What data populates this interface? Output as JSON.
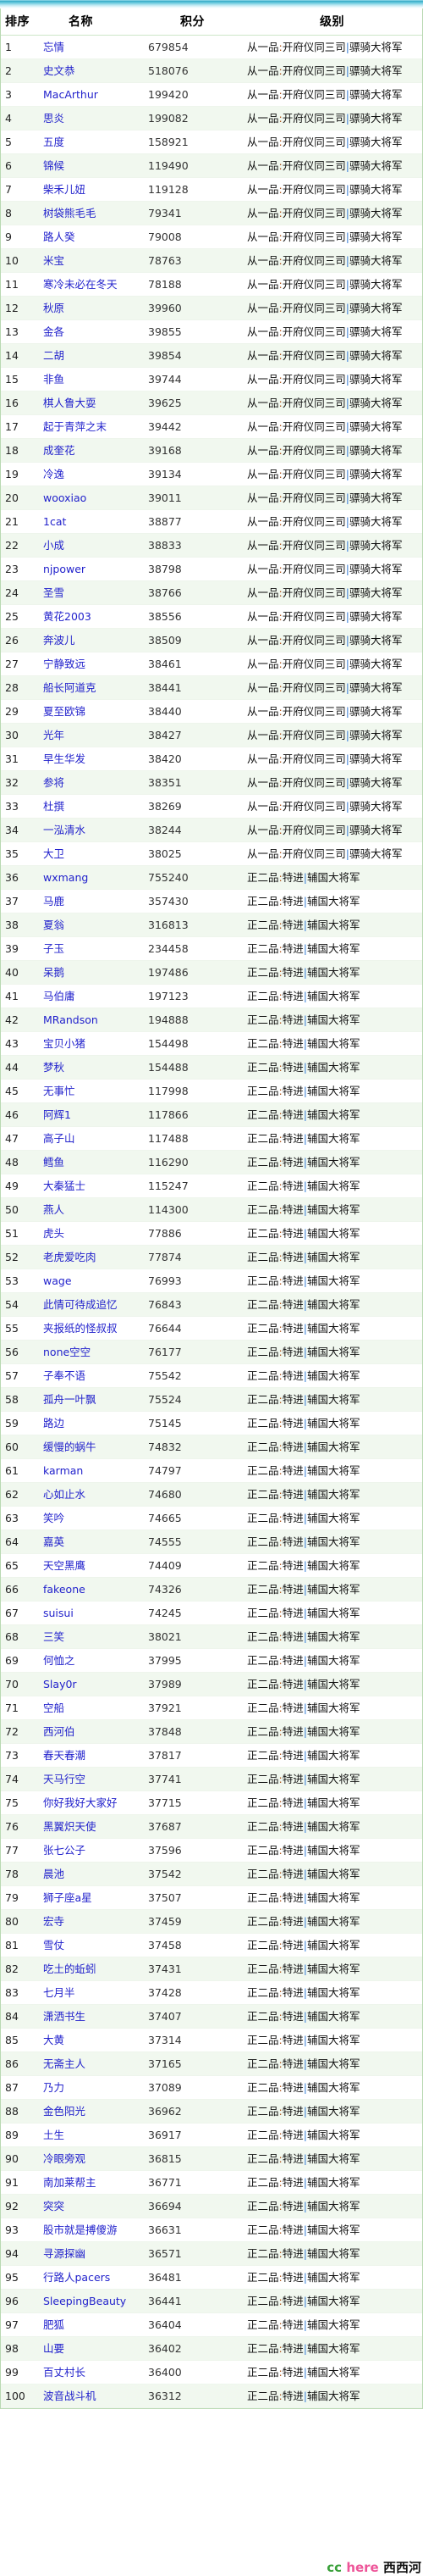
{
  "table": {
    "columns": [
      "排序",
      "名称",
      "积分",
      "级别"
    ],
    "levels": {
      "rank1": "从一品:开府仪同三司|骠骑大将军",
      "rank2": "正二品:特进|辅国大将军"
    },
    "rows": [
      {
        "rank": "1",
        "name": "忘情",
        "score": "679854",
        "grade": "从一品",
        "title": "开府仪同三司",
        "mil": "骠骑大将军"
      },
      {
        "rank": "2",
        "name": "史文恭",
        "score": "518076",
        "grade": "从一品",
        "title": "开府仪同三司",
        "mil": "骠骑大将军"
      },
      {
        "rank": "3",
        "name": "MacArthur",
        "score": "199420",
        "grade": "从一品",
        "title": "开府仪同三司",
        "mil": "骠骑大将军"
      },
      {
        "rank": "4",
        "name": "思炎",
        "score": "199082",
        "grade": "从一品",
        "title": "开府仪同三司",
        "mil": "骠骑大将军"
      },
      {
        "rank": "5",
        "name": "五度",
        "score": "158921",
        "grade": "从一品",
        "title": "开府仪同三司",
        "mil": "骠骑大将军"
      },
      {
        "rank": "6",
        "name": "锦候",
        "score": "119490",
        "grade": "从一品",
        "title": "开府仪同三司",
        "mil": "骠骑大将军"
      },
      {
        "rank": "7",
        "name": "柴禾儿妞",
        "score": "119128",
        "grade": "从一品",
        "title": "开府仪同三司",
        "mil": "骠骑大将军"
      },
      {
        "rank": "8",
        "name": "树袋熊毛毛",
        "score": "79341",
        "grade": "从一品",
        "title": "开府仪同三司",
        "mil": "骠骑大将军"
      },
      {
        "rank": "9",
        "name": "路人癸",
        "score": "79008",
        "grade": "从一品",
        "title": "开府仪同三司",
        "mil": "骠骑大将军"
      },
      {
        "rank": "10",
        "name": "米宝",
        "score": "78763",
        "grade": "从一品",
        "title": "开府仪同三司",
        "mil": "骠骑大将军"
      },
      {
        "rank": "11",
        "name": "寒冷未必在冬天",
        "score": "78188",
        "grade": "从一品",
        "title": "开府仪同三司",
        "mil": "骠骑大将军"
      },
      {
        "rank": "12",
        "name": "秋原",
        "score": "39960",
        "grade": "从一品",
        "title": "开府仪同三司",
        "mil": "骠骑大将军"
      },
      {
        "rank": "13",
        "name": "金各",
        "score": "39855",
        "grade": "从一品",
        "title": "开府仪同三司",
        "mil": "骠骑大将军"
      },
      {
        "rank": "14",
        "name": "二胡",
        "score": "39854",
        "grade": "从一品",
        "title": "开府仪同三司",
        "mil": "骠骑大将军"
      },
      {
        "rank": "15",
        "name": "非鱼",
        "score": "39744",
        "grade": "从一品",
        "title": "开府仪同三司",
        "mil": "骠骑大将军"
      },
      {
        "rank": "16",
        "name": "棋人鲁大耍",
        "score": "39625",
        "grade": "从一品",
        "title": "开府仪同三司",
        "mil": "骠骑大将军"
      },
      {
        "rank": "17",
        "name": "起于青萍之末",
        "score": "39442",
        "grade": "从一品",
        "title": "开府仪同三司",
        "mil": "骠骑大将军"
      },
      {
        "rank": "18",
        "name": "成奎花",
        "score": "39168",
        "grade": "从一品",
        "title": "开府仪同三司",
        "mil": "骠骑大将军"
      },
      {
        "rank": "19",
        "name": "冷逸",
        "score": "39134",
        "grade": "从一品",
        "title": "开府仪同三司",
        "mil": "骠骑大将军"
      },
      {
        "rank": "20",
        "name": "wooxiao",
        "score": "39011",
        "grade": "从一品",
        "title": "开府仪同三司",
        "mil": "骠骑大将军"
      },
      {
        "rank": "21",
        "name": "1cat",
        "score": "38877",
        "grade": "从一品",
        "title": "开府仪同三司",
        "mil": "骠骑大将军"
      },
      {
        "rank": "22",
        "name": "小成",
        "score": "38833",
        "grade": "从一品",
        "title": "开府仪同三司",
        "mil": "骠骑大将军"
      },
      {
        "rank": "23",
        "name": "njpower",
        "score": "38798",
        "grade": "从一品",
        "title": "开府仪同三司",
        "mil": "骠骑大将军"
      },
      {
        "rank": "24",
        "name": "圣雪",
        "score": "38766",
        "grade": "从一品",
        "title": "开府仪同三司",
        "mil": "骠骑大将军"
      },
      {
        "rank": "25",
        "name": "黄花2003",
        "score": "38556",
        "grade": "从一品",
        "title": "开府仪同三司",
        "mil": "骠骑大将军"
      },
      {
        "rank": "26",
        "name": "奔波儿",
        "score": "38509",
        "grade": "从一品",
        "title": "开府仪同三司",
        "mil": "骠骑大将军"
      },
      {
        "rank": "27",
        "name": "宁静致远",
        "score": "38461",
        "grade": "从一品",
        "title": "开府仪同三司",
        "mil": "骠骑大将军"
      },
      {
        "rank": "28",
        "name": "船长阿道克",
        "score": "38441",
        "grade": "从一品",
        "title": "开府仪同三司",
        "mil": "骠骑大将军"
      },
      {
        "rank": "29",
        "name": "夏至欧锦",
        "score": "38440",
        "grade": "从一品",
        "title": "开府仪同三司",
        "mil": "骠骑大将军"
      },
      {
        "rank": "30",
        "name": "光年",
        "score": "38427",
        "grade": "从一品",
        "title": "开府仪同三司",
        "mil": "骠骑大将军"
      },
      {
        "rank": "31",
        "name": "早生华发",
        "score": "38420",
        "grade": "从一品",
        "title": "开府仪同三司",
        "mil": "骠骑大将军"
      },
      {
        "rank": "32",
        "name": "参将",
        "score": "38351",
        "grade": "从一品",
        "title": "开府仪同三司",
        "mil": "骠骑大将军"
      },
      {
        "rank": "33",
        "name": "杜撰",
        "score": "38269",
        "grade": "从一品",
        "title": "开府仪同三司",
        "mil": "骠骑大将军"
      },
      {
        "rank": "34",
        "name": "一泓清水",
        "score": "38244",
        "grade": "从一品",
        "title": "开府仪同三司",
        "mil": "骠骑大将军"
      },
      {
        "rank": "35",
        "name": "大卫",
        "score": "38025",
        "grade": "从一品",
        "title": "开府仪同三司",
        "mil": "骠骑大将军"
      },
      {
        "rank": "36",
        "name": "wxmang",
        "score": "755240",
        "grade": "正二品",
        "title": "特进",
        "mil": "辅国大将军"
      },
      {
        "rank": "37",
        "name": "马鹿",
        "score": "357430",
        "grade": "正二品",
        "title": "特进",
        "mil": "辅国大将军"
      },
      {
        "rank": "38",
        "name": "夏翁",
        "score": "316813",
        "grade": "正二品",
        "title": "特进",
        "mil": "辅国大将军"
      },
      {
        "rank": "39",
        "name": "子玉",
        "score": "234458",
        "grade": "正二品",
        "title": "特进",
        "mil": "辅国大将军"
      },
      {
        "rank": "40",
        "name": "呆鹅",
        "score": "197486",
        "grade": "正二品",
        "title": "特进",
        "mil": "辅国大将军"
      },
      {
        "rank": "41",
        "name": "马伯庸",
        "score": "197123",
        "grade": "正二品",
        "title": "特进",
        "mil": "辅国大将军"
      },
      {
        "rank": "42",
        "name": "MRandson",
        "score": "194888",
        "grade": "正二品",
        "title": "特进",
        "mil": "辅国大将军"
      },
      {
        "rank": "43",
        "name": "宝贝小猪",
        "score": "154498",
        "grade": "正二品",
        "title": "特进",
        "mil": "辅国大将军"
      },
      {
        "rank": "44",
        "name": "梦秋",
        "score": "154488",
        "grade": "正二品",
        "title": "特进",
        "mil": "辅国大将军"
      },
      {
        "rank": "45",
        "name": "无事忙",
        "score": "117998",
        "grade": "正二品",
        "title": "特进",
        "mil": "辅国大将军"
      },
      {
        "rank": "46",
        "name": "阿辉1",
        "score": "117866",
        "grade": "正二品",
        "title": "特进",
        "mil": "辅国大将军"
      },
      {
        "rank": "47",
        "name": "高子山",
        "score": "117488",
        "grade": "正二品",
        "title": "特进",
        "mil": "辅国大将军"
      },
      {
        "rank": "48",
        "name": "鳕鱼",
        "score": "116290",
        "grade": "正二品",
        "title": "特进",
        "mil": "辅国大将军"
      },
      {
        "rank": "49",
        "name": "大秦猛士",
        "score": "115247",
        "grade": "正二品",
        "title": "特进",
        "mil": "辅国大将军"
      },
      {
        "rank": "50",
        "name": "燕人",
        "score": "114300",
        "grade": "正二品",
        "title": "特进",
        "mil": "辅国大将军"
      },
      {
        "rank": "51",
        "name": "虎头",
        "score": "77886",
        "grade": "正二品",
        "title": "特进",
        "mil": "辅国大将军"
      },
      {
        "rank": "52",
        "name": "老虎爱吃肉",
        "score": "77874",
        "grade": "正二品",
        "title": "特进",
        "mil": "辅国大将军"
      },
      {
        "rank": "53",
        "name": "wage",
        "score": "76993",
        "grade": "正二品",
        "title": "特进",
        "mil": "辅国大将军"
      },
      {
        "rank": "54",
        "name": "此情可待成追忆",
        "score": "76843",
        "grade": "正二品",
        "title": "特进",
        "mil": "辅国大将军"
      },
      {
        "rank": "55",
        "name": "夹报纸的怪叔叔",
        "score": "76644",
        "grade": "正二品",
        "title": "特进",
        "mil": "辅国大将军"
      },
      {
        "rank": "56",
        "name": "none空空",
        "score": "76177",
        "grade": "正二品",
        "title": "特进",
        "mil": "辅国大将军"
      },
      {
        "rank": "57",
        "name": "子奉不语",
        "score": "75542",
        "grade": "正二品",
        "title": "特进",
        "mil": "辅国大将军"
      },
      {
        "rank": "58",
        "name": "孤舟一叶飘",
        "score": "75524",
        "grade": "正二品",
        "title": "特进",
        "mil": "辅国大将军"
      },
      {
        "rank": "59",
        "name": "路边",
        "score": "75145",
        "grade": "正二品",
        "title": "特进",
        "mil": "辅国大将军"
      },
      {
        "rank": "60",
        "name": "缓慢的蜗牛",
        "score": "74832",
        "grade": "正二品",
        "title": "特进",
        "mil": "辅国大将军"
      },
      {
        "rank": "61",
        "name": "karman",
        "score": "74797",
        "grade": "正二品",
        "title": "特进",
        "mil": "辅国大将军"
      },
      {
        "rank": "62",
        "name": "心如止水",
        "score": "74680",
        "grade": "正二品",
        "title": "特进",
        "mil": "辅国大将军"
      },
      {
        "rank": "63",
        "name": "笑吟",
        "score": "74665",
        "grade": "正二品",
        "title": "特进",
        "mil": "辅国大将军"
      },
      {
        "rank": "64",
        "name": "嘉英",
        "score": "74555",
        "grade": "正二品",
        "title": "特进",
        "mil": "辅国大将军"
      },
      {
        "rank": "65",
        "name": "天空黑鹰",
        "score": "74409",
        "grade": "正二品",
        "title": "特进",
        "mil": "辅国大将军"
      },
      {
        "rank": "66",
        "name": "fakeone",
        "score": "74326",
        "grade": "正二品",
        "title": "特进",
        "mil": "辅国大将军"
      },
      {
        "rank": "67",
        "name": "suisui",
        "score": "74245",
        "grade": "正二品",
        "title": "特进",
        "mil": "辅国大将军"
      },
      {
        "rank": "68",
        "name": "三笑",
        "score": "38021",
        "grade": "正二品",
        "title": "特进",
        "mil": "辅国大将军"
      },
      {
        "rank": "69",
        "name": "何恤之",
        "score": "37995",
        "grade": "正二品",
        "title": "特进",
        "mil": "辅国大将军"
      },
      {
        "rank": "70",
        "name": "Slay0r",
        "score": "37989",
        "grade": "正二品",
        "title": "特进",
        "mil": "辅国大将军"
      },
      {
        "rank": "71",
        "name": "空船",
        "score": "37921",
        "grade": "正二品",
        "title": "特进",
        "mil": "辅国大将军"
      },
      {
        "rank": "72",
        "name": "西河伯",
        "score": "37848",
        "grade": "正二品",
        "title": "特进",
        "mil": "辅国大将军"
      },
      {
        "rank": "73",
        "name": "春天春潮",
        "score": "37817",
        "grade": "正二品",
        "title": "特进",
        "mil": "辅国大将军"
      },
      {
        "rank": "74",
        "name": "天马行空",
        "score": "37741",
        "grade": "正二品",
        "title": "特进",
        "mil": "辅国大将军"
      },
      {
        "rank": "75",
        "name": "你好我好大家好",
        "score": "37715",
        "grade": "正二品",
        "title": "特进",
        "mil": "辅国大将军"
      },
      {
        "rank": "76",
        "name": "黑翼炽天使",
        "score": "37687",
        "grade": "正二品",
        "title": "特进",
        "mil": "辅国大将军"
      },
      {
        "rank": "77",
        "name": "张七公子",
        "score": "37596",
        "grade": "正二品",
        "title": "特进",
        "mil": "辅国大将军"
      },
      {
        "rank": "78",
        "name": "晨池",
        "score": "37542",
        "grade": "正二品",
        "title": "特进",
        "mil": "辅国大将军"
      },
      {
        "rank": "79",
        "name": "狮子座a星",
        "score": "37507",
        "grade": "正二品",
        "title": "特进",
        "mil": "辅国大将军"
      },
      {
        "rank": "80",
        "name": "宏寺",
        "score": "37459",
        "grade": "正二品",
        "title": "特进",
        "mil": "辅国大将军"
      },
      {
        "rank": "81",
        "name": "雪仗",
        "score": "37458",
        "grade": "正二品",
        "title": "特进",
        "mil": "辅国大将军"
      },
      {
        "rank": "82",
        "name": "吃土的蚯蚓",
        "score": "37431",
        "grade": "正二品",
        "title": "特进",
        "mil": "辅国大将军"
      },
      {
        "rank": "83",
        "name": "七月半",
        "score": "37428",
        "grade": "正二品",
        "title": "特进",
        "mil": "辅国大将军"
      },
      {
        "rank": "84",
        "name": "潇洒书生",
        "score": "37407",
        "grade": "正二品",
        "title": "特进",
        "mil": "辅国大将军"
      },
      {
        "rank": "85",
        "name": "大黄",
        "score": "37314",
        "grade": "正二品",
        "title": "特进",
        "mil": "辅国大将军"
      },
      {
        "rank": "86",
        "name": "无斋主人",
        "score": "37165",
        "grade": "正二品",
        "title": "特进",
        "mil": "辅国大将军"
      },
      {
        "rank": "87",
        "name": "乃力",
        "score": "37089",
        "grade": "正二品",
        "title": "特进",
        "mil": "辅国大将军"
      },
      {
        "rank": "88",
        "name": "金色阳光",
        "score": "36962",
        "grade": "正二品",
        "title": "特进",
        "mil": "辅国大将军"
      },
      {
        "rank": "89",
        "name": "土生",
        "score": "36917",
        "grade": "正二品",
        "title": "特进",
        "mil": "辅国大将军"
      },
      {
        "rank": "90",
        "name": "冷眼旁观",
        "score": "36815",
        "grade": "正二品",
        "title": "特进",
        "mil": "辅国大将军"
      },
      {
        "rank": "91",
        "name": "南加莱帮主",
        "score": "36771",
        "grade": "正二品",
        "title": "特进",
        "mil": "辅国大将军"
      },
      {
        "rank": "92",
        "name": "突突",
        "score": "36694",
        "grade": "正二品",
        "title": "特进",
        "mil": "辅国大将军"
      },
      {
        "rank": "93",
        "name": "股市就是搏傻游",
        "score": "36631",
        "grade": "正二品",
        "title": "特进",
        "mil": "辅国大将军"
      },
      {
        "rank": "94",
        "name": "寻源探幽",
        "score": "36571",
        "grade": "正二品",
        "title": "特进",
        "mil": "辅国大将军"
      },
      {
        "rank": "95",
        "name": "行路人pacers",
        "score": "36481",
        "grade": "正二品",
        "title": "特进",
        "mil": "辅国大将军"
      },
      {
        "rank": "96",
        "name": "SleepingBeauty",
        "score": "36441",
        "grade": "正二品",
        "title": "特进",
        "mil": "辅国大将军"
      },
      {
        "rank": "97",
        "name": "肥狐",
        "score": "36404",
        "grade": "正二品",
        "title": "特进",
        "mil": "辅国大将军"
      },
      {
        "rank": "98",
        "name": "山要",
        "score": "36402",
        "grade": "正二品",
        "title": "特进",
        "mil": "辅国大将军"
      },
      {
        "rank": "99",
        "name": "百丈村长",
        "score": "36400",
        "grade": "正二品",
        "title": "特进",
        "mil": "辅国大将军"
      },
      {
        "rank": "100",
        "name": "波音战斗机",
        "score": "36312",
        "grade": "正二品",
        "title": "特进",
        "mil": "辅国大将军"
      }
    ]
  },
  "watermark": {
    "cc": "cc",
    "here": "here",
    "site": "西西河"
  },
  "colors": {
    "link": "#2222cc",
    "header_gradient_top": "#34a8c4",
    "row_alt": "#f1f8ef",
    "border": "#b9d9b2",
    "colon": "#b05a22",
    "pipe": "#3a7fd5",
    "wm_cc": "#3aa03a",
    "wm_here": "#ee5599"
  }
}
